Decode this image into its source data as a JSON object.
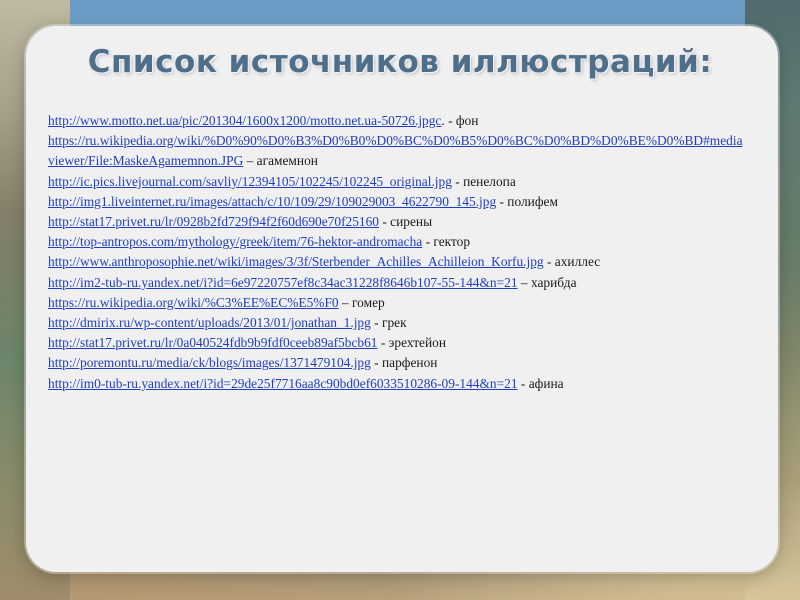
{
  "slide": {
    "title": "Список источников иллюстраций:",
    "sources": [
      {
        "url": "http://www.motto.net.ua/pic/201304/1600x1200/motto.net.ua-50726.jpgc",
        "suffix": ". - фон"
      },
      {
        "url": "https://ru.wikipedia.org/wiki/%D0%90%D0%B3%D0%B0%D0%BC%D0%B5%D0%BC%D0%BD%D0%BE%D0%BD#mediaviewer/File:MaskeAgamemnon.JPG",
        "suffix": " – агамемнон"
      },
      {
        "url": "http://ic.pics.livejournal.com/savliy/12394105/102245/102245_original.jpg",
        "suffix": " - пенелопа"
      },
      {
        "url": "http://img1.liveinternet.ru/images/attach/c/10/109/29/109029003_4622790_145.jpg",
        "suffix": " - полифем"
      },
      {
        "url": "http://stat17.privet.ru/lr/0928b2fd729f94f2f60d690e70f25160",
        "suffix": " - сирены"
      },
      {
        "url": "http://top-antropos.com/mythology/greek/item/76-hektor-andromacha",
        "suffix": " - гектор"
      },
      {
        "url": "http://www.anthroposophie.net/wiki/images/3/3f/Sterbender_Achilles_Achilleion_Korfu.jpg",
        "suffix": " - ахиллес"
      },
      {
        "url": "http://im2-tub-ru.yandex.net/i?id=6e97220757ef8c34ac31228f8646b107-55-144&n=21",
        "suffix": " – харибда"
      },
      {
        "url": "https://ru.wikipedia.org/wiki/%C3%EE%EC%E5%F0",
        "suffix": " – гомер"
      },
      {
        "url": "http://dmirix.ru/wp-content/uploads/2013/01/jonathan_1.jpg",
        "suffix": " - грек"
      },
      {
        "url": "http://stat17.privet.ru/lr/0a040524fdb9b9fdf0ceeb89af5bcb61",
        "suffix": " - эрехтейон"
      },
      {
        "url": "http://poremontu.ru/media/ck/blogs/images/1371479104.jpg",
        "suffix": " - парфенон"
      },
      {
        "url": "http://im0-tub-ru.yandex.net/i?id=29de25f7716aa8c90bd0ef6033510286-09-144&n=21",
        "suffix": " - афина"
      }
    ]
  }
}
